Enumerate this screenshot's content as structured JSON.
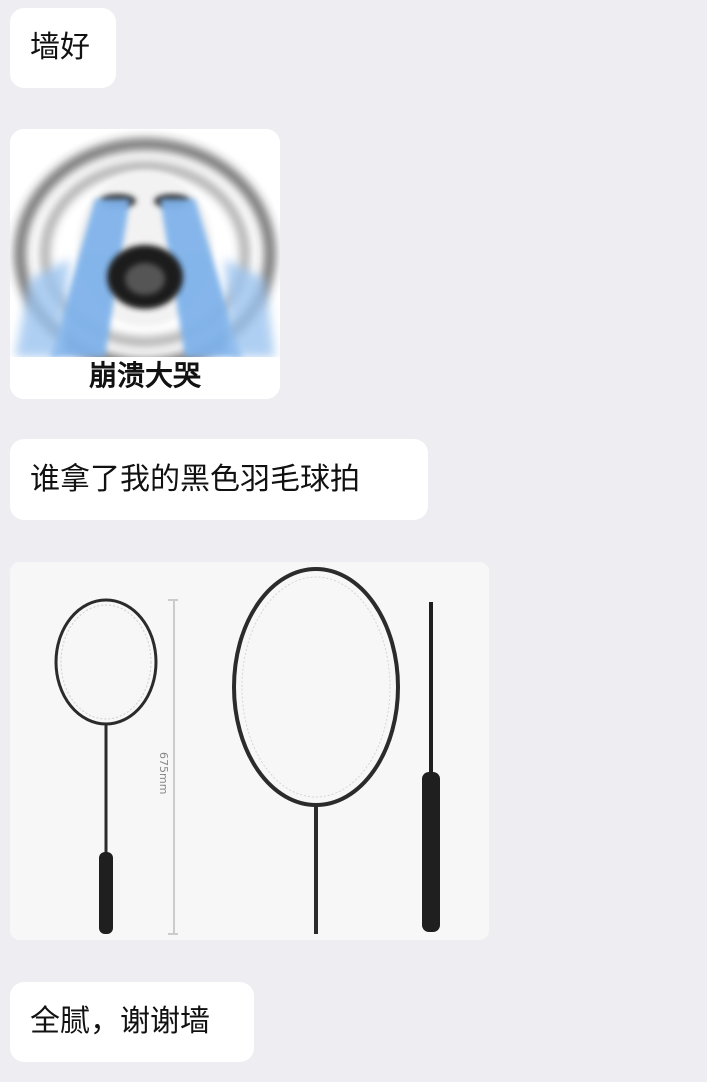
{
  "messages": [
    {
      "type": "text",
      "text": "墙好"
    },
    {
      "type": "sticker",
      "caption": "崩溃大哭"
    },
    {
      "type": "text",
      "text": "谁拿了我的黑色羽毛球拍"
    },
    {
      "type": "image",
      "dimension_label": "675mm"
    },
    {
      "type": "text",
      "text": "全腻，谢谢墙"
    }
  ],
  "colors": {
    "background": "#ededf2",
    "bubble": "#ffffff",
    "text": "#111111",
    "tears": "#7fb2ea"
  }
}
